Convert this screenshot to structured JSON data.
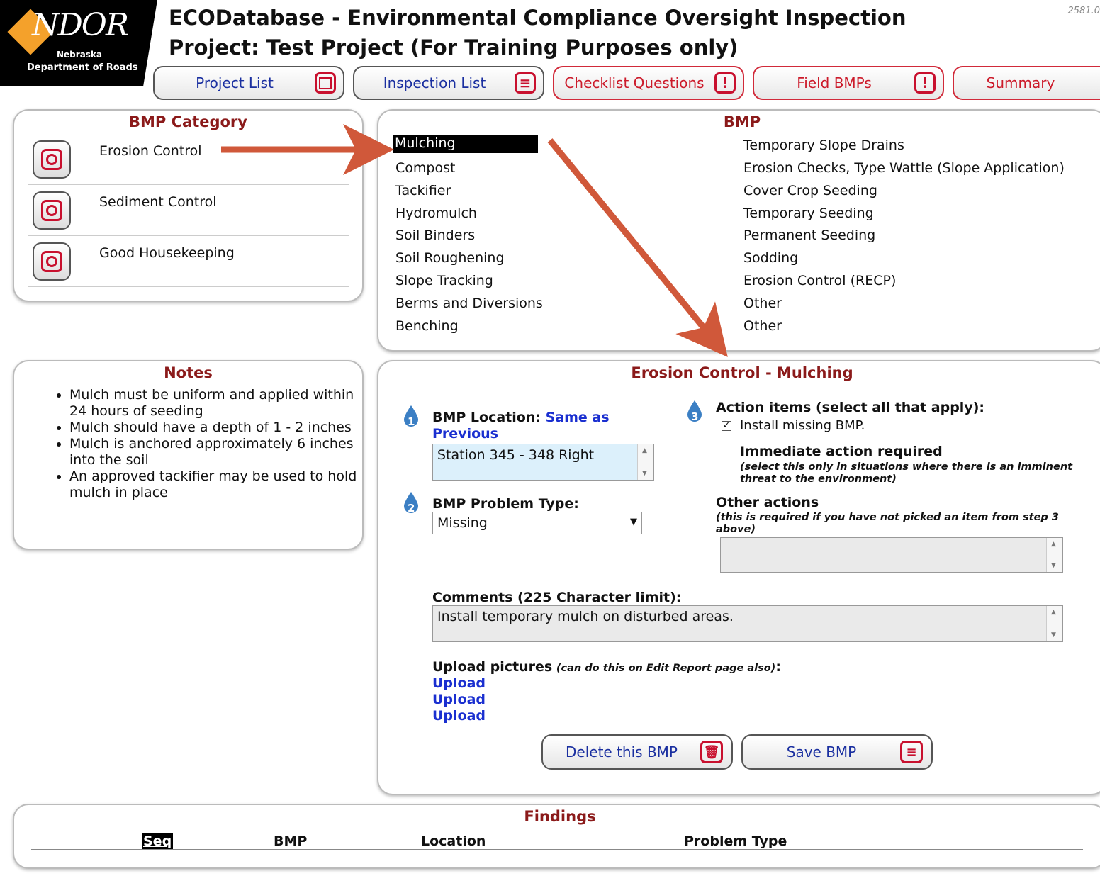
{
  "header": {
    "logo_text": "NDOR",
    "logo_line1": "Nebraska",
    "logo_line2": "Department of Roads",
    "title_line1": "ECODatabase - Environmental Compliance Oversight Inspection",
    "title_line2": "Project: Test Project (For Training Purposes only)",
    "corner_code": "2581.0"
  },
  "nav": {
    "project_list": "Project List",
    "inspection_list": "Inspection List",
    "checklist_questions": "Checklist Questions",
    "field_bmps": "Field BMPs",
    "summary": "Summary"
  },
  "bmp_category": {
    "title": "BMP Category",
    "items": [
      "Erosion Control",
      "Sediment Control",
      "Good Housekeeping"
    ]
  },
  "bmp": {
    "title": "BMP",
    "col1": [
      "Mulching",
      "Compost",
      "Tackifier",
      "Hydromulch",
      "Soil Binders",
      "Soil Roughening",
      "Slope Tracking",
      "Berms and Diversions",
      "Benching"
    ],
    "col2": [
      "Temporary Slope Drains",
      "Erosion Checks, Type Wattle (Slope Application)",
      "Cover Crop Seeding",
      "Temporary Seeding",
      "Permanent Seeding",
      "Sodding",
      "Erosion Control (RECP)",
      "Other",
      "Other"
    ]
  },
  "notes": {
    "title": "Notes",
    "items": [
      "Mulch must be uniform and applied within 24 hours of seeding",
      "Mulch should have a depth of 1 - 2 inches",
      "Mulch is anchored approximately 6 inches into the soil",
      "An approved tackifier may be used to hold mulch in place"
    ]
  },
  "detail": {
    "title": "Erosion Control - Mulching",
    "step1": "1",
    "step2": "2",
    "step3": "3",
    "location_label": "BMP Location:",
    "same_as_previous": "Same as Previous",
    "location_value": "Station 345 - 348 Right",
    "problem_type_label": "BMP Problem Type:",
    "problem_type_value": "Missing",
    "action_items_label": "Action items (select all that apply):",
    "install_missing": "Install missing BMP.",
    "immediate_action": "Immediate action required",
    "immediate_note_a": "(select this ",
    "immediate_note_only": "only",
    "immediate_note_b": " in situations where there is an imminent threat to the environment)",
    "other_actions_label": "Other actions",
    "other_actions_note": "(this is required if you have not picked an item from step 3 above)",
    "other_actions_value": "",
    "comments_label": "Comments (225 Character limit):",
    "comments_value": "Install temporary mulch on disturbed areas.",
    "upload_label": "Upload pictures",
    "upload_note": "(can do this on Edit Report page also)",
    "upload_colon": ":",
    "upload_links": [
      "Upload",
      "Upload",
      "Upload"
    ],
    "delete_button": "Delete this BMP",
    "save_button": "Save BMP"
  },
  "findings": {
    "title": "Findings",
    "columns": [
      "Seq",
      "BMP",
      "Location",
      "Problem Type"
    ]
  },
  "colors": {
    "accent_red": "#c8102e",
    "title_maroon": "#8b1a1a",
    "link_blue": "#1a2fd0",
    "annotation_arrow": "#d0583a"
  }
}
